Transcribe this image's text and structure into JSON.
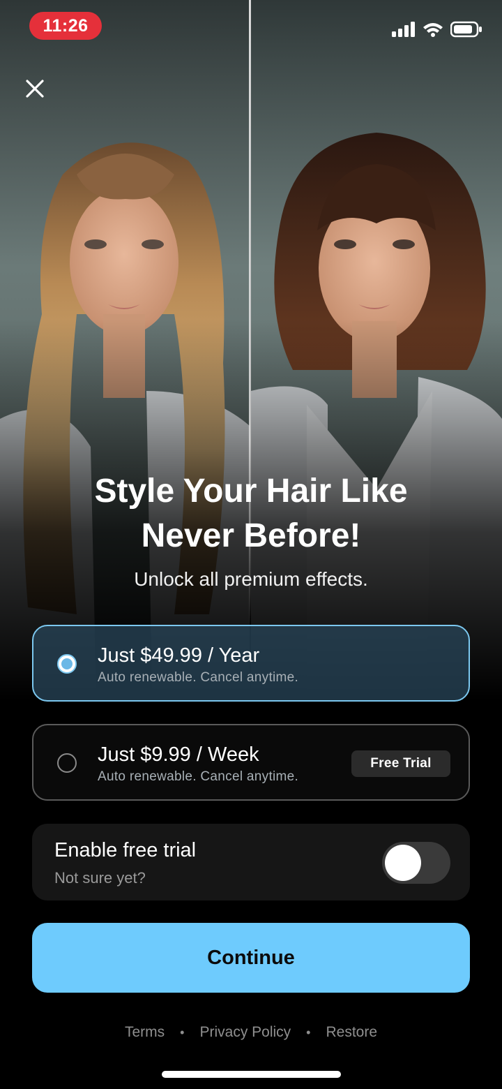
{
  "status_bar": {
    "time": "11:26",
    "icons": [
      "cellular-signal-icon",
      "wifi-icon",
      "battery-icon"
    ]
  },
  "hero": {
    "left_label": "long-blonde-hair-photo",
    "right_label": "brown-bob-with-bangs-photo"
  },
  "headline": {
    "line1": "Style Your Hair Like",
    "line2": "Never Before!",
    "subtitle": "Unlock all premium effects."
  },
  "plans": [
    {
      "title": "Just $49.99 / Year",
      "subtitle": "Auto renewable. Cancel anytime.",
      "selected": true
    },
    {
      "title": "Just $9.99 / Week",
      "subtitle": "Auto renewable. Cancel anytime.",
      "badge": "Free Trial",
      "selected": false
    }
  ],
  "free_trial": {
    "title": "Enable free trial",
    "subtitle": "Not sure yet?",
    "enabled": false
  },
  "cta": {
    "label": "Continue"
  },
  "footer": {
    "links": [
      "Terms",
      "Privacy Policy",
      "Restore"
    ],
    "separator": "•"
  },
  "colors": {
    "accent": "#6ecbfd",
    "selected_border": "#7cc8f0",
    "time_pill": "#e5303a",
    "background": "#000000"
  }
}
